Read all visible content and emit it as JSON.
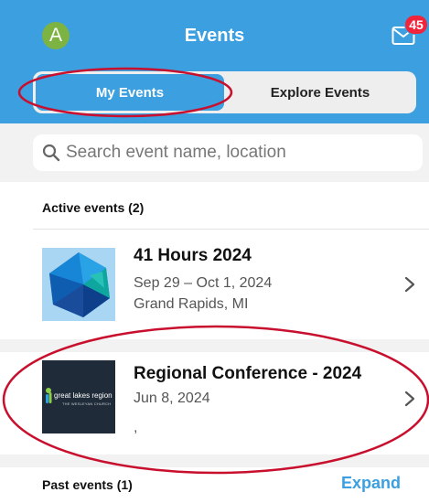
{
  "header": {
    "avatar_letter": "A",
    "title": "Events",
    "badge_count": "45",
    "mail_icon": "envelope-icon",
    "accent_color": "#3b9fe0"
  },
  "tabs": [
    {
      "label": "My Events",
      "selected": true
    },
    {
      "label": "Explore Events",
      "selected": false
    }
  ],
  "search": {
    "placeholder": "Search event name, location"
  },
  "active_section": {
    "heading": "Active events (2)"
  },
  "events": [
    {
      "title": "41 Hours 2024",
      "date": "Sep 29 – Oct 1, 2024",
      "location": "Grand Rapids, MI"
    },
    {
      "title": "Regional Conference - 2024",
      "date": "Jun 8, 2024",
      "location": ",",
      "logo_text": "great lakes region",
      "logo_sub": "THE WESLEYAN CHURCH"
    }
  ],
  "past_section": {
    "heading": "Past events (1)",
    "expand_label": "Expand"
  }
}
